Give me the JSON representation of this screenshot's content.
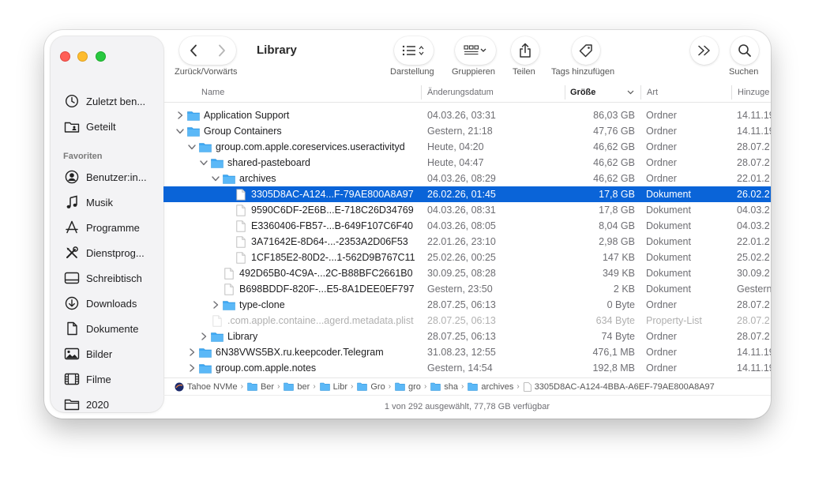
{
  "window": {
    "title": "Library",
    "nav_label": "Zurück/Vorwärts"
  },
  "toolbar": {
    "view_label": "Darstellung",
    "group_label": "Gruppieren",
    "share_label": "Teilen",
    "tags_label": "Tags hinzufügen",
    "search_label": "Suchen"
  },
  "sidebar": {
    "section_favorites": "Favoriten",
    "items": [
      {
        "label": "Zuletzt ben...",
        "icon": "clock-icon"
      },
      {
        "label": "Geteilt",
        "icon": "shared-folder-icon"
      },
      {
        "label": "Benutzer:in...",
        "icon": "person-icon"
      },
      {
        "label": "Musik",
        "icon": "music-note-icon"
      },
      {
        "label": "Programme",
        "icon": "applications-icon"
      },
      {
        "label": "Dienstprog...",
        "icon": "utilities-icon"
      },
      {
        "label": "Schreibtisch",
        "icon": "desktop-icon"
      },
      {
        "label": "Downloads",
        "icon": "downloads-icon"
      },
      {
        "label": "Dokumente",
        "icon": "document-icon"
      },
      {
        "label": "Bilder",
        "icon": "photo-icon"
      },
      {
        "label": "Filme",
        "icon": "film-icon"
      },
      {
        "label": "2020",
        "icon": "folder-icon"
      }
    ]
  },
  "columns": {
    "name": "Name",
    "date": "Änderungsdatum",
    "size": "Größe",
    "kind": "Art",
    "added": "Hinzuge"
  },
  "rows": [
    {
      "name": "Application Support",
      "date": "04.03.26, 03:31",
      "size": "86,03 GB",
      "kind": "Ordner",
      "added": "14.11.19",
      "type": "folder",
      "level": 0,
      "disclosure": "closed"
    },
    {
      "name": "Group Containers",
      "date": "Gestern, 21:18",
      "size": "47,76 GB",
      "kind": "Ordner",
      "added": "14.11.19",
      "type": "folder",
      "level": 0,
      "disclosure": "open"
    },
    {
      "name": "group.com.apple.coreservices.useractivityd",
      "date": "Heute, 04:20",
      "size": "46,62 GB",
      "kind": "Ordner",
      "added": "28.07.2",
      "type": "folder",
      "level": 1,
      "disclosure": "open"
    },
    {
      "name": "shared-pasteboard",
      "date": "Heute, 04:47",
      "size": "46,62 GB",
      "kind": "Ordner",
      "added": "28.07.2",
      "type": "folder",
      "level": 2,
      "disclosure": "open"
    },
    {
      "name": "archives",
      "date": "04.03.26, 08:29",
      "size": "46,62 GB",
      "kind": "Ordner",
      "added": "22.01.2",
      "type": "folder",
      "level": 3,
      "disclosure": "open"
    },
    {
      "name": "3305D8AC-A124...F-79AE800A8A97",
      "date": "26.02.26, 01:45",
      "size": "17,8 GB",
      "kind": "Dokument",
      "added": "26.02.2",
      "type": "file",
      "level": 4,
      "disclosure": "none",
      "selected": true
    },
    {
      "name": "9590C6DF-2E6B...E-718C26D34769",
      "date": "04.03.26, 08:31",
      "size": "17,8 GB",
      "kind": "Dokument",
      "added": "04.03.2",
      "type": "file",
      "level": 4,
      "disclosure": "none"
    },
    {
      "name": "E3360406-FB57-...B-649F107C6F40",
      "date": "04.03.26, 08:05",
      "size": "8,04 GB",
      "kind": "Dokument",
      "added": "04.03.2",
      "type": "file",
      "level": 4,
      "disclosure": "none"
    },
    {
      "name": "3A71642E-8D64-...-2353A2D06F53",
      "date": "22.01.26, 23:10",
      "size": "2,98 GB",
      "kind": "Dokument",
      "added": "22.01.2",
      "type": "file",
      "level": 4,
      "disclosure": "none"
    },
    {
      "name": "1CF185E2-80D2-...1-562D9B767C11",
      "date": "25.02.26, 00:25",
      "size": "147 KB",
      "kind": "Dokument",
      "added": "25.02.2",
      "type": "file",
      "level": 4,
      "disclosure": "none"
    },
    {
      "name": "492D65B0-4C9A-...2C-B88BFC2661B0",
      "date": "30.09.25, 08:28",
      "size": "349 KB",
      "kind": "Dokument",
      "added": "30.09.2",
      "type": "file",
      "level": 3,
      "disclosure": "none"
    },
    {
      "name": "B698BDDF-820F-...E5-8A1DEE0EF797",
      "date": "Gestern, 23:50",
      "size": "2 KB",
      "kind": "Dokument",
      "added": "Gestern",
      "type": "file",
      "level": 3,
      "disclosure": "none"
    },
    {
      "name": "type-clone",
      "date": "28.07.25, 06:13",
      "size": "0 Byte",
      "kind": "Ordner",
      "added": "28.07.2",
      "type": "folder",
      "level": 3,
      "disclosure": "closed"
    },
    {
      "name": ".com.apple.containe...agerd.metadata.plist",
      "date": "28.07.25, 06:13",
      "size": "634 Byte",
      "kind": "Property-List",
      "added": "28.07.2",
      "type": "file",
      "level": 2,
      "disclosure": "none",
      "dim": true
    },
    {
      "name": "Library",
      "date": "28.07.25, 06:13",
      "size": "74 Byte",
      "kind": "Ordner",
      "added": "28.07.2",
      "type": "folder",
      "level": 2,
      "disclosure": "closed"
    },
    {
      "name": "6N38VWS5BX.ru.keepcoder.Telegram",
      "date": "31.08.23, 12:55",
      "size": "476,1 MB",
      "kind": "Ordner",
      "added": "14.11.19",
      "type": "folder",
      "level": 1,
      "disclosure": "closed"
    },
    {
      "name": "group.com.apple.notes",
      "date": "Gestern, 14:54",
      "size": "192,8 MB",
      "kind": "Ordner",
      "added": "14.11.19",
      "type": "folder",
      "level": 1,
      "disclosure": "closed"
    }
  ],
  "pathbar": [
    {
      "label": "Tahoe NVMe",
      "icon": "drive-icon"
    },
    {
      "label": "Ber",
      "icon": "folder-icon"
    },
    {
      "label": "ber",
      "icon": "folder-icon"
    },
    {
      "label": "Libr",
      "icon": "folder-icon"
    },
    {
      "label": "Gro",
      "icon": "folder-icon"
    },
    {
      "label": "gro",
      "icon": "folder-icon"
    },
    {
      "label": "sha",
      "icon": "folder-icon"
    },
    {
      "label": "archives",
      "icon": "folder-icon"
    },
    {
      "label": "3305D8AC-A124-4BBA-A6EF-79AE800A8A97",
      "icon": "file-icon"
    }
  ],
  "status": "1 von 292 ausgewählt, 77,78 GB verfügbar",
  "colors": {
    "selection": "#0a64d8",
    "folder": "#3fa9f5",
    "close": "#ff5f57",
    "minimize": "#febc2e",
    "zoom": "#28c840"
  }
}
